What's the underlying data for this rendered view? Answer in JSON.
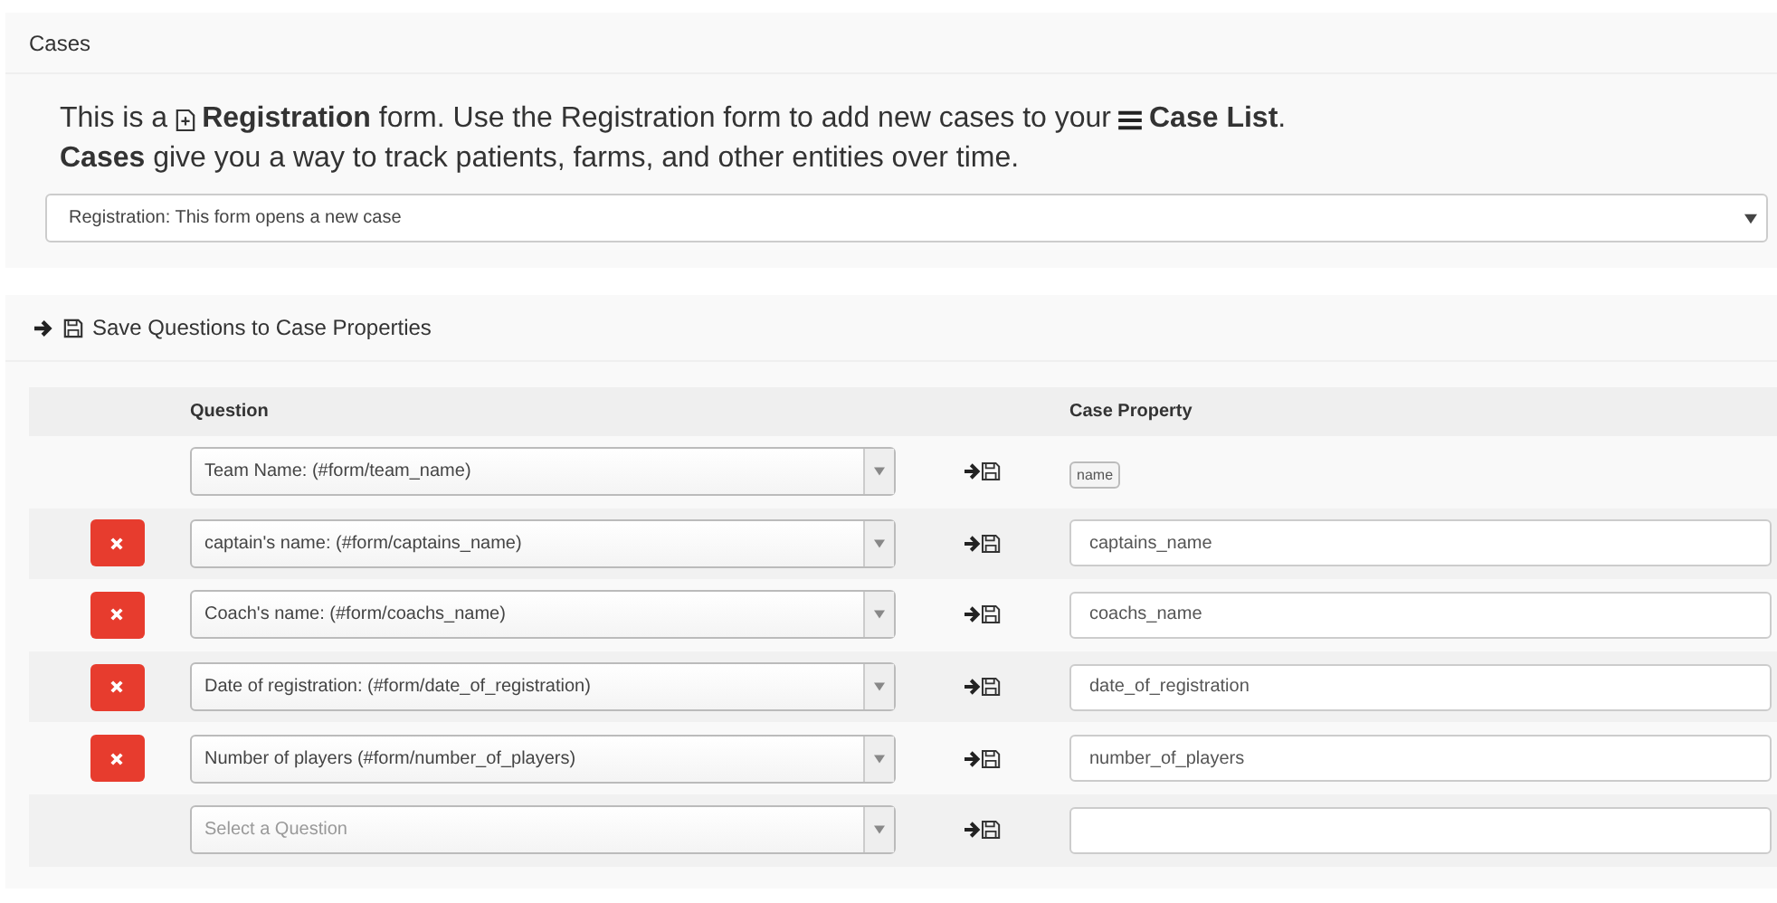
{
  "cases_panel": {
    "title": "Cases",
    "intro": {
      "part_1": "This is a",
      "part_2": "**Registration** form. Use the Registration form to add new cases to your",
      "part_3": "**Case List**."
    },
    "description": "**Cases** give you a way to track patients, farms, and other entities over time.",
    "form_type_select": {
      "value": "Registration: This form opens a new case"
    }
  },
  "save_panel": {
    "title": "Save Questions to Case Properties",
    "columns": [
      "Question",
      "Case Property"
    ],
    "rows": [
      {
        "kind": "fixed",
        "question": "Team Name: (#form/team_name)",
        "property": "name"
      },
      {
        "kind": "mapped",
        "question": "captain's name: (#form/captains_name)",
        "property": "captains_name"
      },
      {
        "kind": "mapped",
        "question": "Coach's name: (#form/coachs_name)",
        "property": "coachs_name"
      },
      {
        "kind": "mapped",
        "question": "Date of registration: (#form/date_of_registration)",
        "property": "date_of_registration"
      },
      {
        "kind": "mapped",
        "question": "Number of players (#form/number_of_players)",
        "property": "number_of_players"
      },
      {
        "kind": "new",
        "question_placeholder": "Select a Question"
      }
    ]
  }
}
